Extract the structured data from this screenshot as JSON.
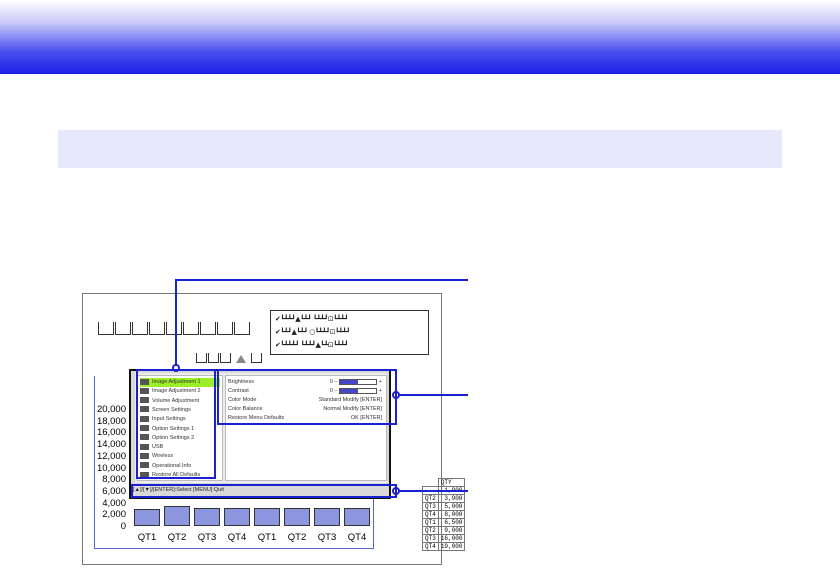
{
  "colors": {
    "callout": "#1a22d0",
    "bar": "#8c96de",
    "menu_active": "#9bee28",
    "banner": "#1a20e6"
  },
  "chart_data": {
    "type": "bar",
    "categories": [
      "QT1",
      "QT2",
      "QT3",
      "QT4",
      "QT1",
      "QT2",
      "QT3",
      "QT4"
    ],
    "y_ticks": [
      "20,000",
      "18,000",
      "16,000",
      "14,000",
      "12,000",
      "10,000",
      "8,000",
      "6,000",
      "4,000",
      "2,000",
      "0"
    ],
    "ylim": [
      0,
      20000
    ],
    "values": [
      1900,
      2400,
      2000,
      2000,
      2000,
      2000,
      2000,
      2000
    ]
  },
  "menu": {
    "items": [
      {
        "label": "Image Adjustment 1",
        "icon": "image-icon"
      },
      {
        "label": "Image Adjustment 2",
        "icon": "image-icon"
      },
      {
        "label": "Volume Adjustment",
        "icon": "speaker-icon"
      },
      {
        "label": "Screen Settings",
        "icon": "screen-icon"
      },
      {
        "label": "Input Settings",
        "icon": "input-icon"
      },
      {
        "label": "Option Settings 1",
        "icon": "options-icon"
      },
      {
        "label": "Option Settings 2",
        "icon": "options-icon"
      },
      {
        "label": "USB",
        "icon": "usb-icon"
      },
      {
        "label": "Wireless",
        "icon": "wireless-icon"
      },
      {
        "label": "Operational Info",
        "icon": "info-icon"
      },
      {
        "label": "Restore All Defaults",
        "icon": "restore-icon"
      }
    ],
    "settings": [
      {
        "label": "Brightness",
        "value": "0",
        "slider": 0.5,
        "plus": "+",
        "minus": "−"
      },
      {
        "label": "Contrast",
        "value": "0",
        "slider": 0.5,
        "plus": "+",
        "minus": "−"
      },
      {
        "label": "Color Mode",
        "value": "Standard",
        "action": "Modify [ENTER]"
      },
      {
        "label": "Color Balance",
        "value": "Normal",
        "action": "Modify [ENTER]"
      },
      {
        "label": "Restore Menu Defaults",
        "value": "",
        "action": "OK [ENTER]"
      }
    ],
    "footer": "[▲]/[▼]/[ENTER]:Select [MENU]:Quit"
  },
  "qty_table": {
    "header": "QTY",
    "rows": [
      {
        "q": "",
        "v": "1,900"
      },
      {
        "q": "QT2",
        "v": "3,900"
      },
      {
        "q": "QT3",
        "v": "5,000"
      },
      {
        "q": "QT4",
        "v": "8,000"
      },
      {
        "q": "QT1",
        "v": "6,500"
      },
      {
        "q": "QT2",
        "v": "9,000"
      },
      {
        "q": "QT3",
        "v": "16,000"
      },
      {
        "q": "QT4",
        "v": "19,000"
      }
    ]
  },
  "legend_rows": [
    "✔┗┻┻┛▲┗┻┛ ┗┻┻┛⊡┗┻┻┛",
    "✔┗┻┛▲┗┻┛ ○┗┻┻┛⊡┗┻┻┛",
    "✔┗┻┻┻┛ ┗┻┻┛▲┗┻⊡┗┻┻┛"
  ]
}
